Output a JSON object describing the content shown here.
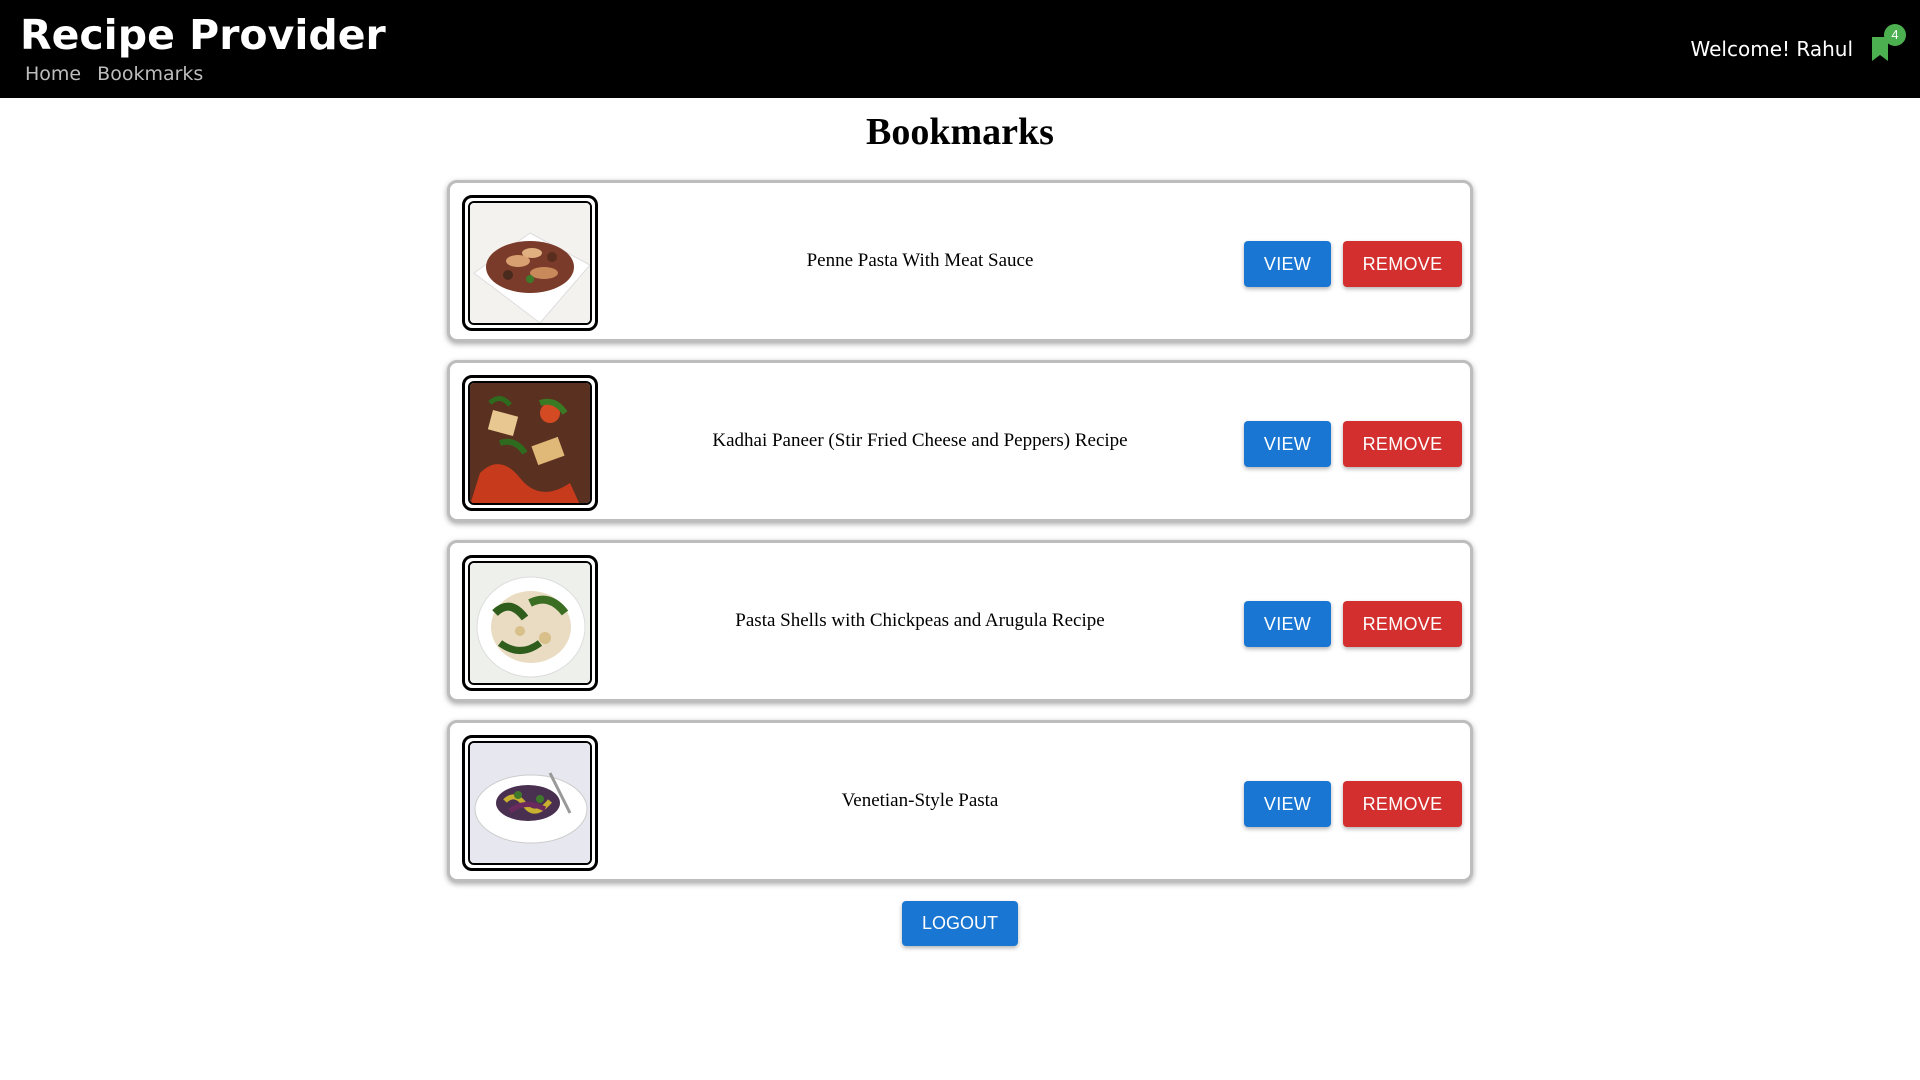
{
  "header": {
    "title": "Recipe Provider",
    "nav": [
      "Home",
      "Bookmarks"
    ],
    "welcome": "Welcome! Rahul",
    "bookmark_count": "4",
    "bookmark_icon": "bookmark-icon",
    "accent": "#4caf50"
  },
  "main": {
    "title": "Bookmarks",
    "items": [
      {
        "name": "Penne Pasta With Meat Sauce",
        "view_label": "VIEW",
        "remove_label": "REMOVE"
      },
      {
        "name": "Kadhai Paneer (Stir Fried Cheese and Peppers) Recipe",
        "view_label": "VIEW",
        "remove_label": "REMOVE"
      },
      {
        "name": "Pasta Shells with Chickpeas and Arugula Recipe",
        "view_label": "VIEW",
        "remove_label": "REMOVE"
      },
      {
        "name": "Venetian-Style Pasta",
        "view_label": "VIEW",
        "remove_label": "REMOVE"
      }
    ],
    "logout_label": "LOGOUT"
  },
  "colors": {
    "primary": "#1976d2",
    "danger": "#d32f2f",
    "header_bg": "#000000"
  }
}
